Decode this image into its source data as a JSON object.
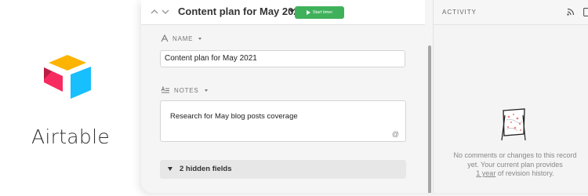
{
  "brand": {
    "name": "Airtable",
    "colors": {
      "yellow": "#fcb400",
      "pink": "#f82b60",
      "blue": "#18bfff",
      "dark_red": "#ba1e45"
    }
  },
  "record": {
    "title": "Content plan for May 2021",
    "timer_button": "Start timer",
    "fields": {
      "name": {
        "label": "NAME",
        "value": "Content plan for May 2021"
      },
      "notes": {
        "label": "NOTES",
        "value": "Research for May blog posts coverage"
      }
    },
    "hidden_fields_label": "2 hidden fields"
  },
  "activity": {
    "title": "ACTIVITY",
    "empty_line1": "No comments or changes to this record",
    "empty_line2": "yet. Your current plan provides",
    "history_link": "1 year",
    "empty_line3_suffix": " of revision history."
  },
  "colors": {
    "accent_green": "#3fb15b",
    "panel_bg": "#f5f5f5",
    "input_border": "#d4d4d4"
  },
  "icons": [
    "airtable-logo",
    "chevron-up-icon",
    "chevron-down-icon",
    "caret-down-icon",
    "play-icon",
    "text-field-icon",
    "long-text-icon",
    "mention-icon",
    "rss-icon",
    "collapse-panel-icon",
    "empty-history-illustration"
  ]
}
